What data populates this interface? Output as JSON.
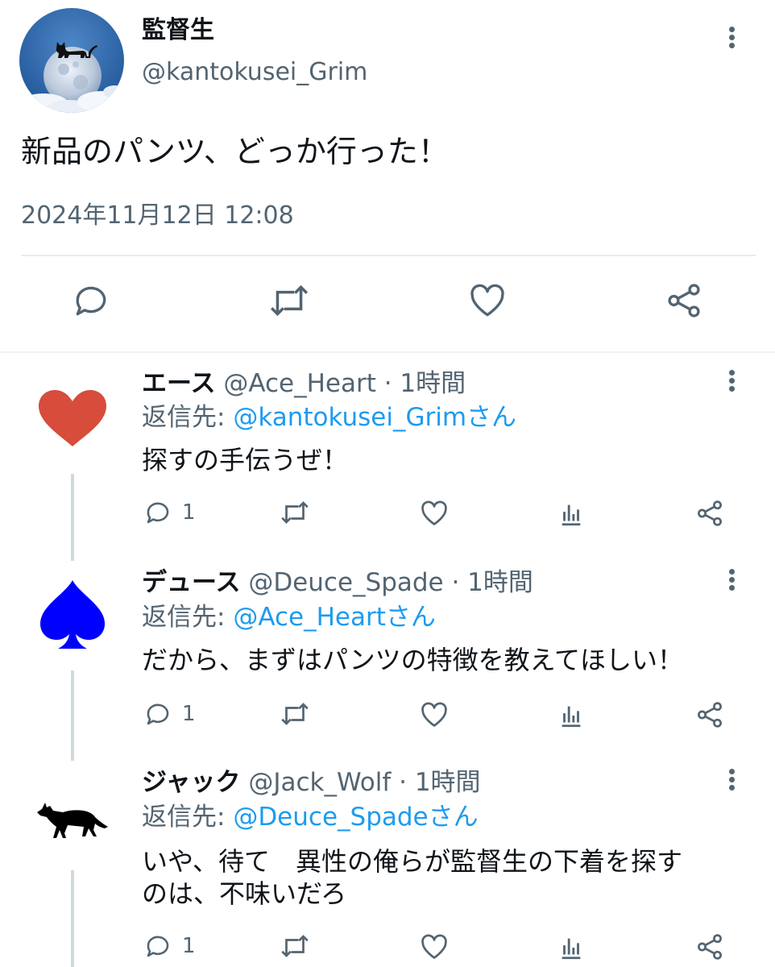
{
  "main_tweet": {
    "display_name": "監督生",
    "handle": "@kantokusei_Grim",
    "text": "新品のパンツ、どっか行った！",
    "timestamp": "2024年11月12日 12:08",
    "icons": [
      "reply-icon",
      "retweet-icon",
      "like-icon",
      "share-icon"
    ]
  },
  "replies": [
    {
      "display_name": "エース",
      "meta": "@Ace_Heart · 1時間",
      "reply_prefix": "返信先: ",
      "reply_to": "@kantokusei_Grimさん",
      "text": "探すの手伝うぜ！",
      "reply_count": "1",
      "avatar": "heart-avatar",
      "avatar_color": "#d74c3a"
    },
    {
      "display_name": "デュース",
      "meta": "@Deuce_Spade · 1時間",
      "reply_prefix": "返信先: ",
      "reply_to": "@Ace_Heartさん",
      "text": "だから、まずはパンツの特徴を教えてほしい！",
      "reply_count": "1",
      "avatar": "spade-avatar",
      "avatar_color": "#0000ff"
    },
    {
      "display_name": "ジャック",
      "meta": "@Jack_Wolf · 1時間",
      "reply_prefix": "返信先: ",
      "reply_to": "@Deuce_Spadeさん",
      "text_line1": "いや、待て　異性の俺らが監督生の下着を探す",
      "text_line2": "のは、不味いだろ",
      "reply_count": "1",
      "avatar": "wolf-avatar",
      "avatar_color": "#000000"
    }
  ],
  "colors": {
    "text": "#0f1419",
    "secondary": "#536471",
    "link": "#1d9bf0",
    "divider": "#e7ecf0"
  }
}
